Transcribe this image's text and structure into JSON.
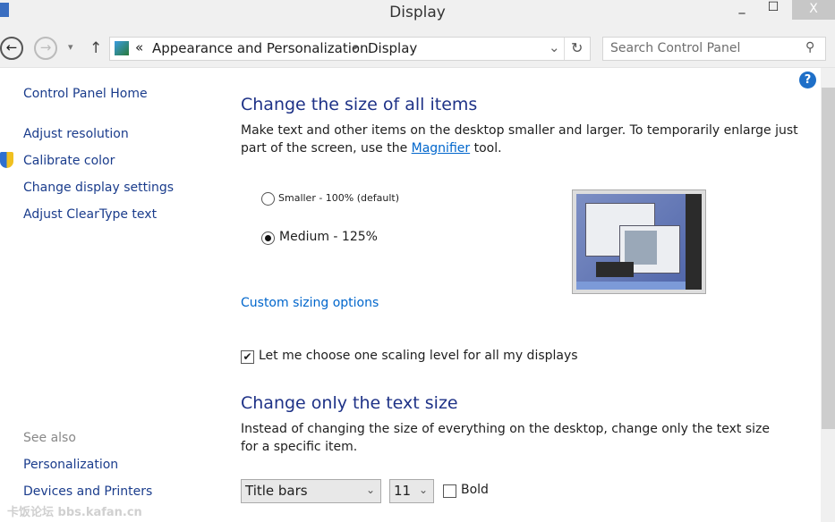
{
  "window": {
    "title": "Display",
    "minimize": "_",
    "maximize": "☐",
    "close": "X"
  },
  "toolbar": {
    "back": "←",
    "forward": "→",
    "dropdown": "▾",
    "up": "↑",
    "refresh": "↻",
    "breadcrumb": {
      "overflow": "«",
      "items": [
        "Appearance and Personalization",
        "Display"
      ],
      "separator": "▸",
      "dropdown": "⌄"
    },
    "search": {
      "placeholder": "Search Control Panel",
      "icon": "⚲"
    }
  },
  "help": "?",
  "sidebar": {
    "home": "Control Panel Home",
    "items": [
      "Adjust resolution",
      "Calibrate color",
      "Change display settings",
      "Adjust ClearType text"
    ],
    "see_also": "See also",
    "see_also_items": [
      "Personalization",
      "Devices and Printers"
    ]
  },
  "main": {
    "section1": {
      "title": "Change the size of all items",
      "desc_before": "Make text and other items on the desktop smaller and larger. To temporarily enlarge just part of the screen, use the ",
      "desc_link": "Magnifier",
      "desc_after": " tool.",
      "options": [
        {
          "label": "Smaller - 100% (default)",
          "selected": false
        },
        {
          "label": "Medium - 125%",
          "selected": true
        }
      ],
      "custom_link": "Custom sizing options",
      "checkbox": {
        "label": "Let me choose one scaling level for all my displays",
        "checked": true
      }
    },
    "section2": {
      "title": "Change only the text size",
      "desc": "Instead of changing the size of everything on the desktop, change only the text size for a specific item.",
      "item_select": "Title bars",
      "size_select": "11",
      "bold": {
        "label": "Bold",
        "checked": false
      }
    }
  },
  "watermark": "卡饭论坛 bbs.kafan.cn",
  "colors": {
    "heading": "#1e3287",
    "link": "#0066cc",
    "preview_blue": "#4d63a8"
  }
}
